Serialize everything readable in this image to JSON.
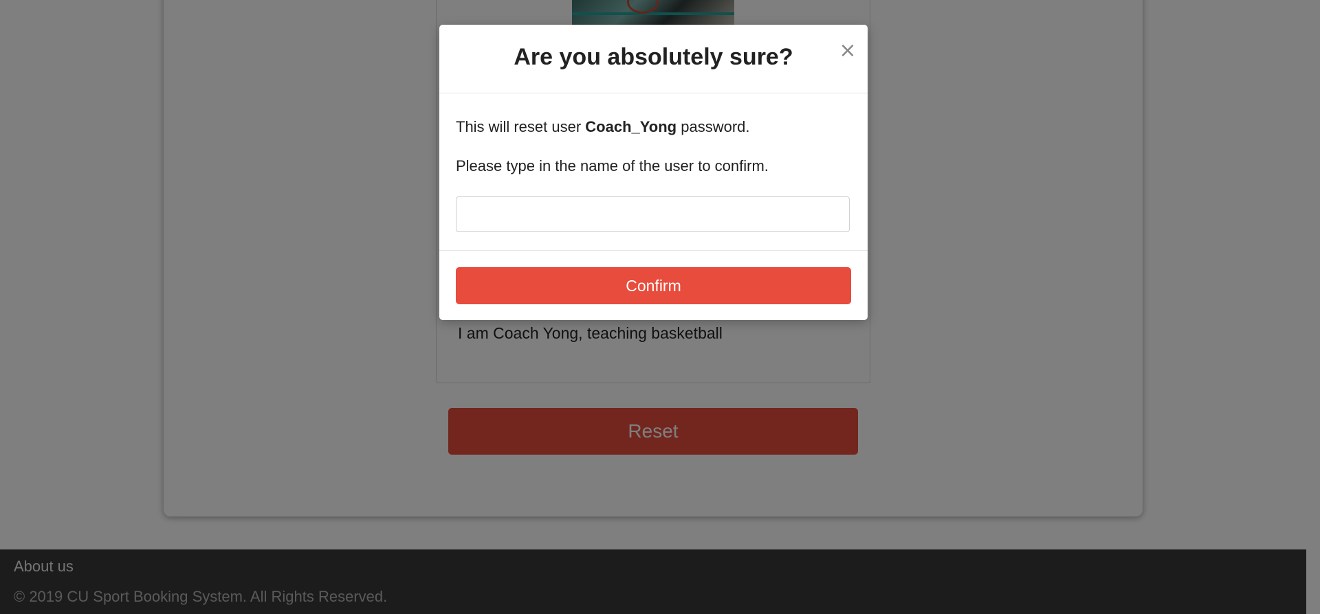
{
  "profile": {
    "description": "I am Coach Yong, teaching basketball",
    "reset_label": "Reset"
  },
  "footer": {
    "about_label": "About us",
    "copyright": "© 2019 CU Sport Booking System. All Rights Reserved."
  },
  "modal": {
    "title": "Are you absolutely sure?",
    "close_symbol": "×",
    "line1_prefix": "This will reset user ",
    "username": "Coach_Yong",
    "line1_suffix": " password.",
    "line2": "Please type in the name of the user to confirm.",
    "input_value": "",
    "confirm_label": "Confirm"
  },
  "colors": {
    "danger": "#e74c3c",
    "footer_bg": "#393939"
  }
}
